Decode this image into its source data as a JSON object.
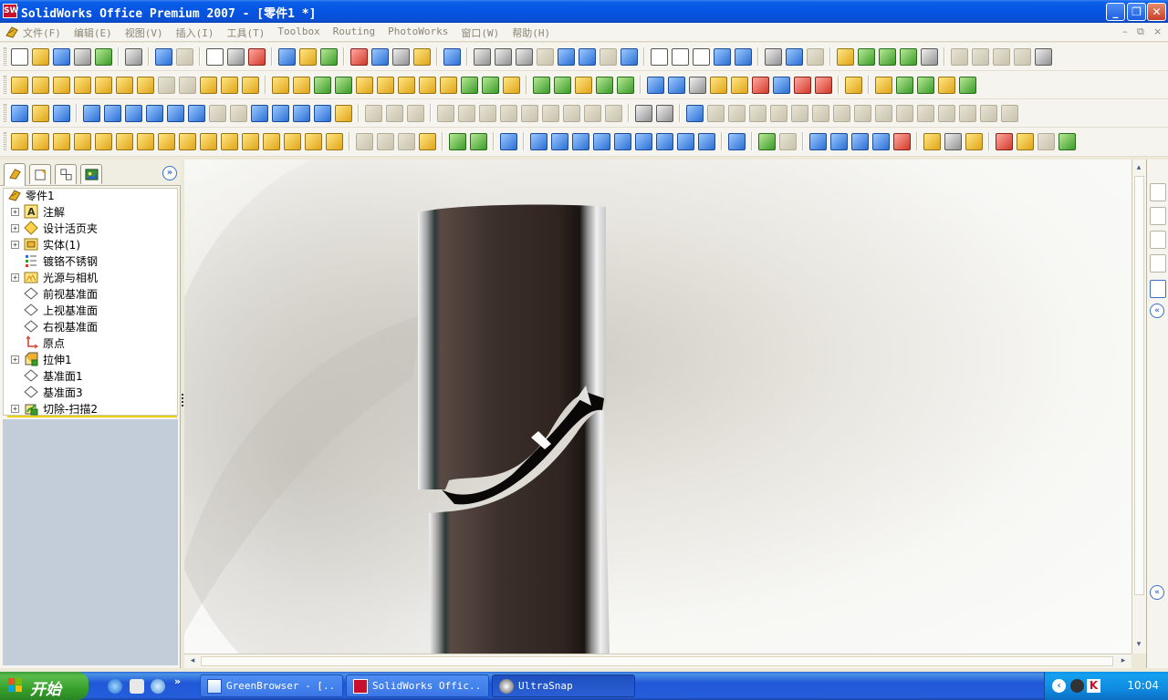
{
  "window": {
    "title": "SolidWorks Office Premium 2007 - [零件1 *]",
    "logo_text": "SW",
    "minimize": "_",
    "maximize": "❐",
    "close": "✕"
  },
  "menubar": {
    "items": [
      "文件(F)",
      "编辑(E)",
      "视图(V)",
      "插入(I)",
      "工具(T)",
      "Toolbox",
      "Routing",
      "PhotoWorks",
      "窗口(W)",
      "帮助(H)"
    ],
    "mdi_controls": [
      "–",
      "⧉",
      "×"
    ]
  },
  "feature_manager": {
    "tabs": [
      "FeatureManager",
      "PropertyManager",
      "ConfigurationManager",
      "PhotoWorks"
    ],
    "expand_label": "»",
    "root": "零件1",
    "items": [
      {
        "label": "注解",
        "expandable": true,
        "icon": "annotations-icon"
      },
      {
        "label": "设计活页夹",
        "expandable": true,
        "icon": "design-binder-icon"
      },
      {
        "label": "实体(1)",
        "expandable": true,
        "icon": "solid-bodies-icon"
      },
      {
        "label": "镀铬不锈钢",
        "expandable": false,
        "icon": "material-icon"
      },
      {
        "label": "光源与相机",
        "expandable": true,
        "icon": "lights-cameras-icon"
      },
      {
        "label": "前视基准面",
        "expandable": false,
        "icon": "plane-icon"
      },
      {
        "label": "上视基准面",
        "expandable": false,
        "icon": "plane-icon"
      },
      {
        "label": "右视基准面",
        "expandable": false,
        "icon": "plane-icon"
      },
      {
        "label": "原点",
        "expandable": false,
        "icon": "origin-icon"
      },
      {
        "label": "拉伸1",
        "expandable": true,
        "icon": "extrude-icon"
      },
      {
        "label": "基准面1",
        "expandable": false,
        "icon": "plane-icon"
      },
      {
        "label": "基准面3",
        "expandable": false,
        "icon": "plane-icon"
      },
      {
        "label": "切除-扫描2",
        "expandable": true,
        "icon": "cut-sweep-icon"
      }
    ]
  },
  "colors": {
    "titlebar": "#0554e3",
    "rollback_bar": "#e8d000",
    "taskbar": "#245edb",
    "start_button": "#37a12c"
  },
  "taskbar": {
    "start_label": "开始",
    "quick_launch_more": "»",
    "tasks": [
      {
        "label": "GreenBrowser - [...",
        "icon": "greenbrowser-icon",
        "active": false
      },
      {
        "label": "SolidWorks Offic...",
        "icon": "solidworks-icon",
        "active": false
      },
      {
        "label": "UltraSnap",
        "icon": "ultrasnap-icon",
        "active": true
      }
    ],
    "clock": "10:04"
  }
}
